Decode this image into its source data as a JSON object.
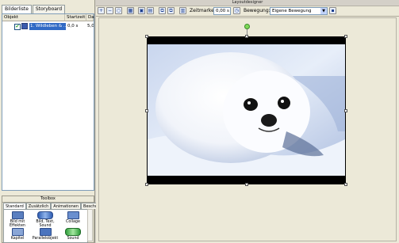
{
  "left_panel": {
    "tabs": [
      "Bilderliste",
      "Storyboard"
    ],
    "columns": {
      "objekt": "Objekt",
      "startzeit": "Startzeit",
      "dauer": "Da"
    },
    "rows": [
      {
        "index_name": "1. Wildleben & ...",
        "startzeit": "0,0 s",
        "dauer": "5,0"
      }
    ]
  },
  "toolbox": {
    "title": "Toolbox",
    "tabs": [
      "Standard",
      "Zusätzlich",
      "Animationen",
      "Beschriftu"
    ],
    "items": [
      {
        "label": "Bild mit Effekten",
        "icon": "image-effects-icon"
      },
      {
        "label": "Bild, Text, Sound",
        "icon": "image-text-sound-icon"
      },
      {
        "label": "Collage",
        "icon": "collage-icon"
      },
      {
        "label": "Kapitel",
        "icon": "chapter-icon"
      },
      {
        "label": "Parallelobjekt",
        "icon": "parallel-object-icon"
      },
      {
        "label": "Sound",
        "icon": "sound-icon"
      }
    ]
  },
  "designer": {
    "title": "Layoutdesigner",
    "zeitmarke_label": "Zeitmarke:",
    "zeitmarke_value": "0,00 s",
    "bewegung_label": "Bewegung:",
    "bewegung_value": "Eigene Bewegung"
  }
}
